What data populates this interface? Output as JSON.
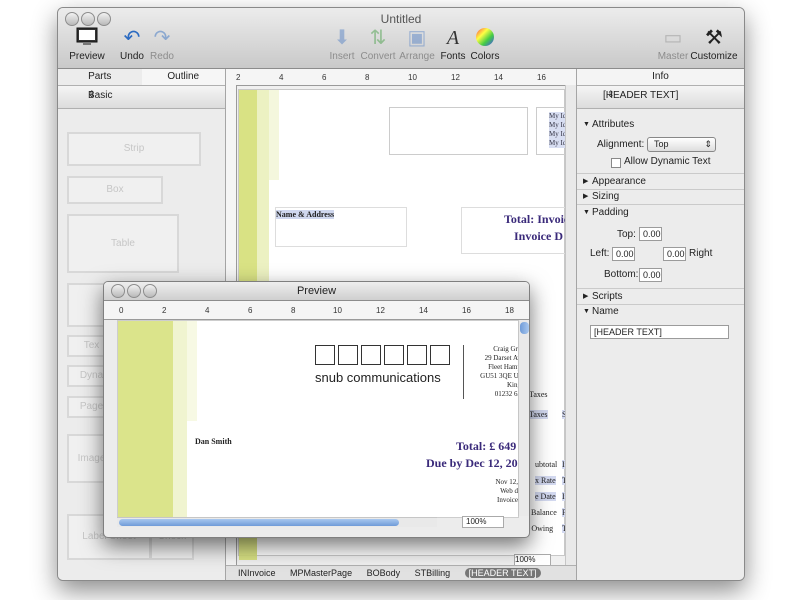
{
  "main_window": {
    "title": "Untitled",
    "toolbar": {
      "preview": "Preview",
      "undo": "Undo",
      "redo": "Redo",
      "insert": "Insert",
      "convert": "Convert",
      "arrange": "Arrange",
      "fonts": "Fonts",
      "colors": "Colors",
      "master": "Master",
      "customize": "Customize"
    }
  },
  "left_panel": {
    "tabs": [
      "Parts",
      "Outline"
    ],
    "category": "Basic",
    "items": [
      "Strip",
      "Box",
      "Table",
      "Gr",
      "Tex",
      "Dyna",
      "Page",
      "Image",
      "Label Sheet",
      "Check"
    ]
  },
  "canvas": {
    "ruler_top": [
      "2",
      "4",
      "6",
      "8",
      "10",
      "12",
      "14",
      "16"
    ],
    "ruler_left": [
      "2",
      "4",
      "6",
      "8",
      "10",
      "12",
      "14",
      "16",
      "18",
      "20",
      "22"
    ],
    "name_address": "Name & Address",
    "header_lines": [
      "My Id",
      "My Id",
      "My Id",
      "My Id"
    ],
    "total_invoice": "Total: Invoic",
    "invoice_due": "Invoice D",
    "table_rows": [
      "Taxes",
      "Taxes",
      "S",
      "ubtotal",
      "In",
      "x Rate",
      "T",
      "e Date",
      "In",
      "Previous Balance",
      "Pa",
      "Total Owing",
      "T"
    ],
    "zoom": "100%",
    "breadcrumbs": [
      "INInvoice",
      "MPMasterPage",
      "BOBody",
      "STBilling",
      "[HEADER TEXT]"
    ]
  },
  "info_panel": {
    "title": "Info",
    "selected": "[HEADER TEXT]",
    "sections": {
      "attributes": "Attributes",
      "alignment_label": "Alignment:",
      "alignment_value": "Top",
      "allow_dynamic": "Allow Dynamic Text",
      "appearance": "Appearance",
      "sizing": "Sizing",
      "padding": "Padding",
      "top_label": "Top:",
      "top_value": "0.00",
      "left_label": "Left:",
      "left_value": "0.00",
      "right_value": "0.00",
      "right_label": "Right",
      "bottom_label": "Bottom:",
      "bottom_value": "0.00",
      "scripts": "Scripts",
      "name": "Name",
      "name_value": "[HEADER TEXT]"
    }
  },
  "preview_window": {
    "title": "Preview",
    "ruler": [
      "0",
      "2",
      "4",
      "6",
      "8",
      "10",
      "12",
      "14",
      "16",
      "18"
    ],
    "company": "snub communications",
    "address_lines": [
      "Craig Gra",
      "29 Darset Av",
      "Fleet Hamp",
      "GU51 3QE UI",
      "King",
      "01232 62"
    ],
    "customer": "Dan Smith",
    "total": "Total: £ 649",
    "due": "Due by Dec 12, 20",
    "date_lines": [
      "Nov 12,",
      "Web d",
      "Invoice"
    ],
    "zoom": "100%"
  }
}
